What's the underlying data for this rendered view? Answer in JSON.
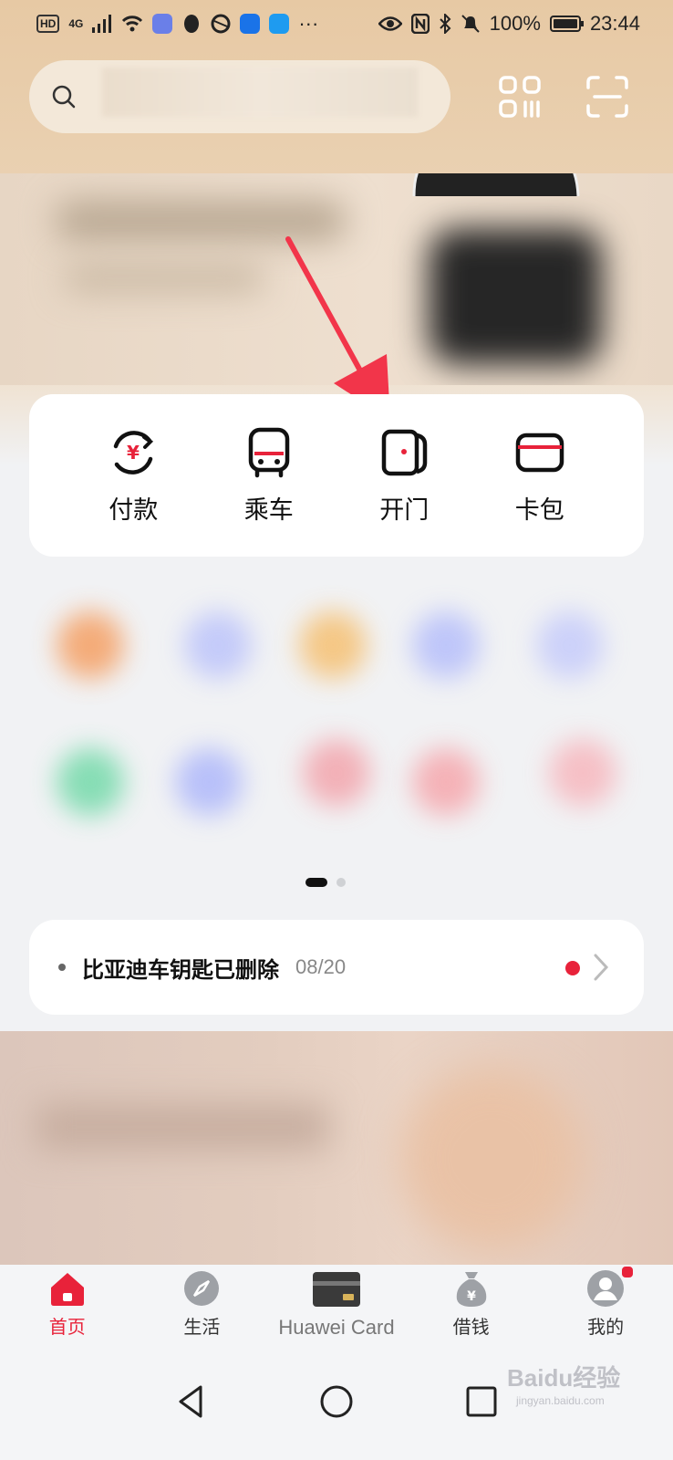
{
  "status_bar": {
    "hd": "HD",
    "network": "4G",
    "more": "···",
    "battery": "100%",
    "time": "23:44"
  },
  "search": {
    "placeholder": ""
  },
  "quick_actions": [
    {
      "label": "付款",
      "icon": "pay-icon"
    },
    {
      "label": "乘车",
      "icon": "bus-icon"
    },
    {
      "label": "开门",
      "icon": "door-icon"
    },
    {
      "label": "卡包",
      "icon": "card-icon"
    }
  ],
  "notice": {
    "text": "比亚迪车钥匙已删除",
    "date": "08/20"
  },
  "tabs": [
    {
      "label": "首页",
      "icon": "home-icon",
      "active": true
    },
    {
      "label": "生活",
      "icon": "compass-icon"
    },
    {
      "label": "Huawei Card",
      "icon": "huawei-card-icon"
    },
    {
      "label": "借钱",
      "icon": "money-bag-icon"
    },
    {
      "label": "我的",
      "icon": "profile-icon"
    }
  ],
  "watermark": {
    "brand": "Baidu经验",
    "url": "jingyan.baidu.com"
  },
  "colors": {
    "accent": "#e8223a",
    "annotation_arrow": "#f2354a"
  }
}
